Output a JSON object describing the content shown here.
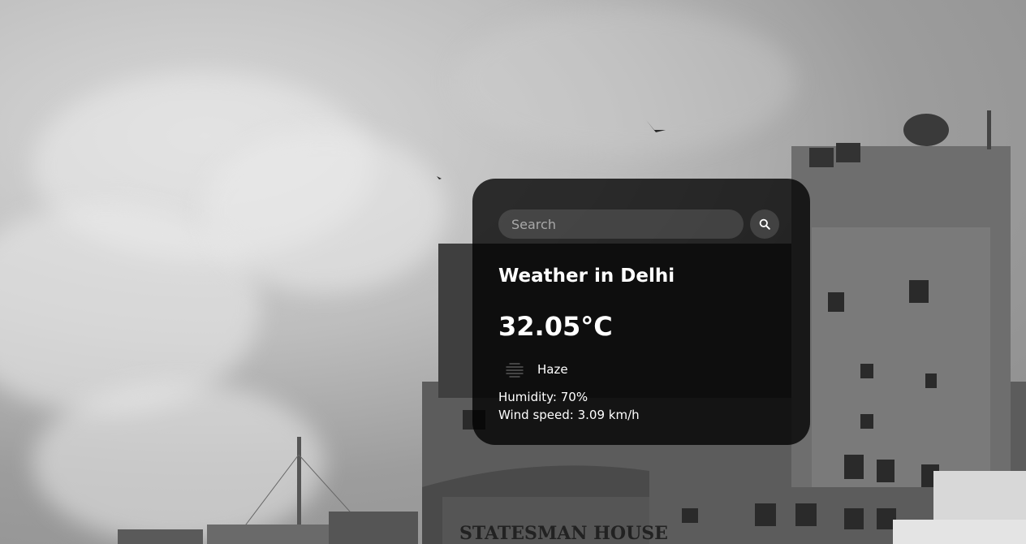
{
  "search": {
    "placeholder": "Search",
    "value": ""
  },
  "weather": {
    "title": "Weather in Delhi",
    "temperature": "32.05°C",
    "description": "Haze",
    "humidity": "Humidity: 70%",
    "wind": "Wind speed: 3.09 km/h"
  },
  "background": {
    "sign_text": "STATESMAN HOUSE"
  },
  "colors": {
    "card": "#1a1a1a",
    "text": "#ffffff",
    "input": "#5a5a5a"
  },
  "icons": {
    "search": "search-icon",
    "condition": "haze-icon"
  }
}
